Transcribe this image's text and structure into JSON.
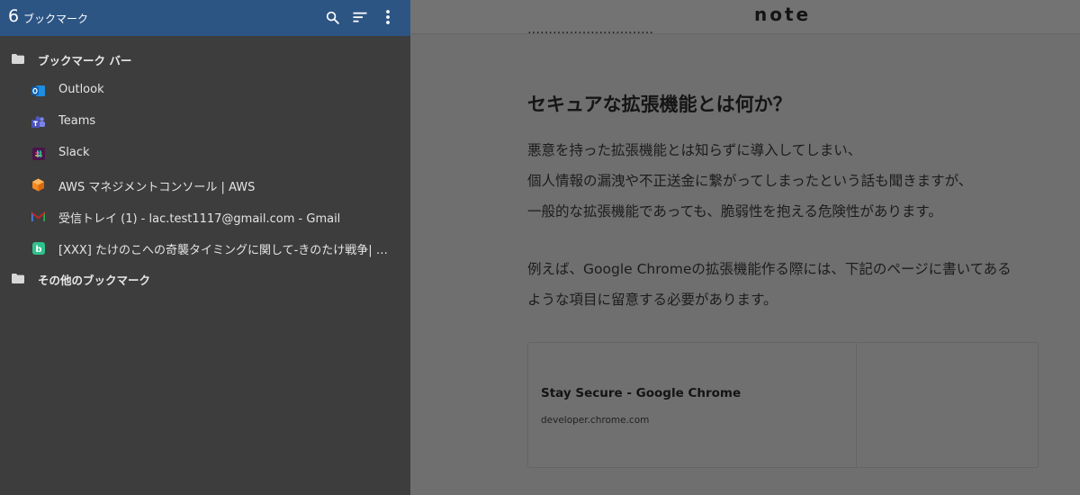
{
  "page": {
    "logo": "note",
    "cut_text": "…………………………",
    "heading": "セキュアな拡張機能とは何か？",
    "para1": [
      "悪意を持った拡張機能とは知らずに導入してしまい、",
      "個人情報の漏洩や不正送金に繋がってしまったという話も聞きますが、",
      "一般的な拡張機能であっても、脆弱性を抱える危険性があります。"
    ],
    "para2": [
      "例えば、Google Chromeの拡張機能作る際には、下記のページに書いてある",
      "ような項目に留意する必要があります。"
    ],
    "card": {
      "title": "Stay Secure - Google Chrome",
      "domain": "developer.chrome.com"
    }
  },
  "panel": {
    "count": "6",
    "title": "ブックマーク",
    "icons": {
      "search": "search-icon",
      "sort": "sort-icon",
      "more": "more-vert-icon"
    },
    "header_color": "#2c5584",
    "rows": [
      {
        "type": "folder",
        "label": "ブックマーク バー",
        "icon": "folder-icon"
      },
      {
        "type": "item",
        "label": "Outlook",
        "icon": "outlook-icon"
      },
      {
        "type": "item",
        "label": "Teams",
        "icon": "teams-icon"
      },
      {
        "type": "item",
        "label": "Slack",
        "icon": "slack-icon"
      },
      {
        "type": "item",
        "label": "AWS マネジメントコンソール | AWS",
        "icon": "aws-icon"
      },
      {
        "type": "item",
        "label": "受信トレイ (1) - lac.test1117@gmail.com - Gmail",
        "icon": "gmail-icon"
      },
      {
        "type": "item",
        "label": "[XXX] たけのこへの奇襲タイミングに関して-きのたけ戦争| Wiki",
        "icon": "wiki-icon"
      },
      {
        "type": "folder",
        "label": "その他のブックマーク",
        "icon": "folder-icon"
      }
    ]
  }
}
